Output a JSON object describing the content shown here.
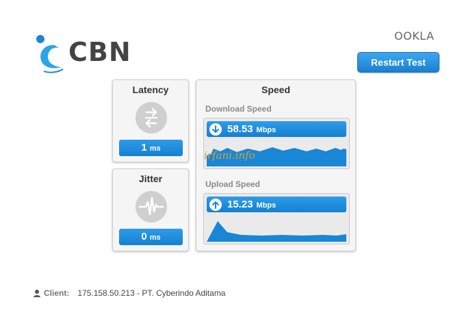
{
  "brand": {
    "logo_text": "CBN",
    "logo_color": "#1a86d6"
  },
  "provider": {
    "name": "OOKLA"
  },
  "actions": {
    "restart_label": "Restart Test"
  },
  "latency": {
    "title": "Latency",
    "value": "1",
    "unit": "ms",
    "icon": "arrows-exchange-icon"
  },
  "jitter": {
    "title": "Jitter",
    "value": "0",
    "unit": "ms",
    "icon": "pulse-wave-icon"
  },
  "speed": {
    "title": "Speed",
    "download": {
      "label": "Download Speed",
      "value": "58.53",
      "unit": "Mbps",
      "icon": "arrow-down-icon"
    },
    "upload": {
      "label": "Upload Speed",
      "value": "15.23",
      "unit": "Mbps",
      "icon": "arrow-up-icon"
    }
  },
  "watermark": "irfani.info",
  "client": {
    "label": "Client:",
    "value": "175.158.50.213 - PT. Cyberindo Aditama"
  },
  "colors": {
    "accent": "#1a86d6",
    "panel_bg": "#f5f5f5"
  }
}
